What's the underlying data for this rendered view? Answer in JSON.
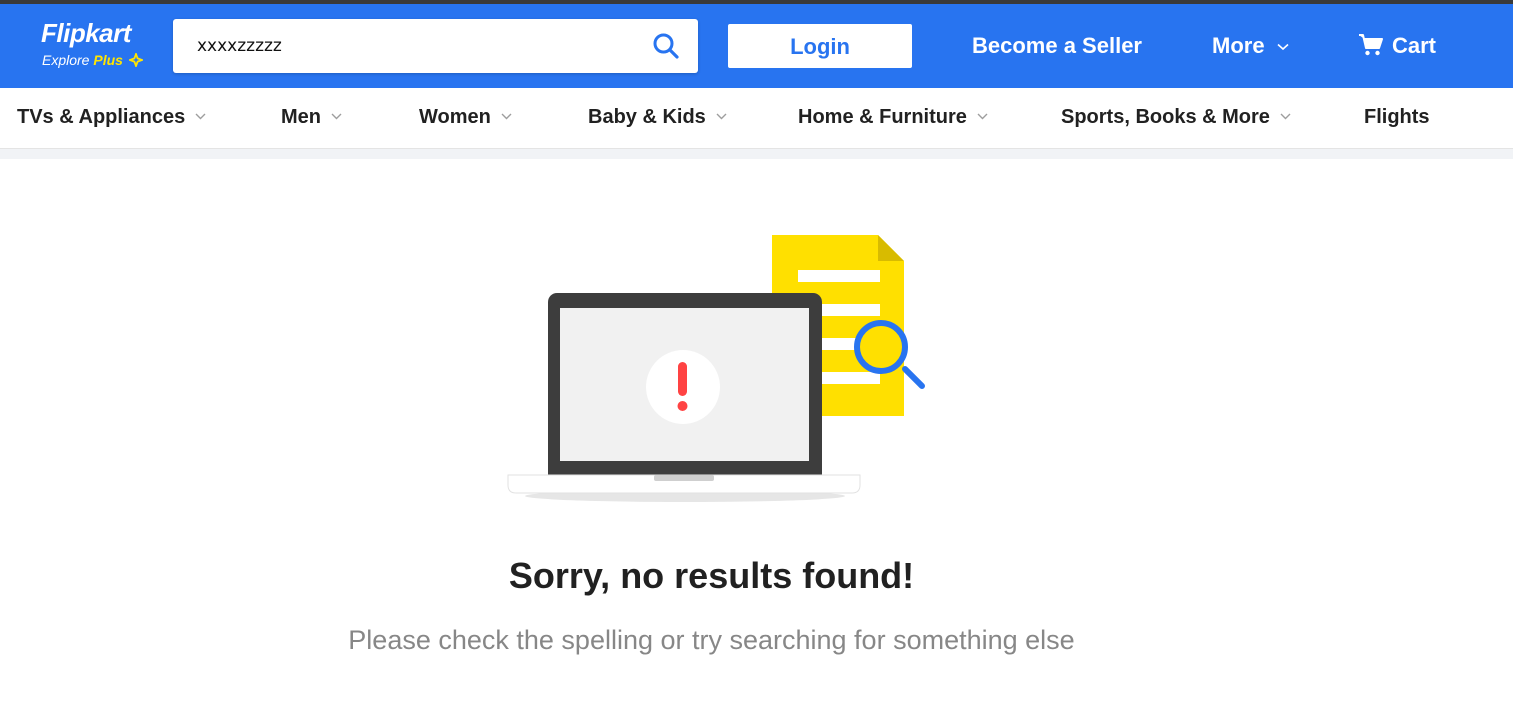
{
  "header": {
    "logo_text": "Flipkart",
    "logo_sub_explore": "Explore",
    "logo_sub_plus": "Plus",
    "search_value": "xxxxzzzzz",
    "login_label": "Login",
    "become_seller_label": "Become a Seller",
    "more_label": "More",
    "cart_label": "Cart",
    "brand_color": "#2874f0",
    "plus_color": "#ffe500"
  },
  "categories": [
    {
      "label": "TVs & Appliances",
      "has_dropdown": true
    },
    {
      "label": "Men",
      "has_dropdown": true
    },
    {
      "label": "Women",
      "has_dropdown": true
    },
    {
      "label": "Baby & Kids",
      "has_dropdown": true
    },
    {
      "label": "Home & Furniture",
      "has_dropdown": true
    },
    {
      "label": "Sports, Books & More",
      "has_dropdown": true
    },
    {
      "label": "Flights",
      "has_dropdown": false
    }
  ],
  "empty_state": {
    "title": "Sorry, no results found!",
    "subtitle": "Please check the spelling or try searching for something else",
    "illustration": "laptop-error-document-search-icon"
  }
}
